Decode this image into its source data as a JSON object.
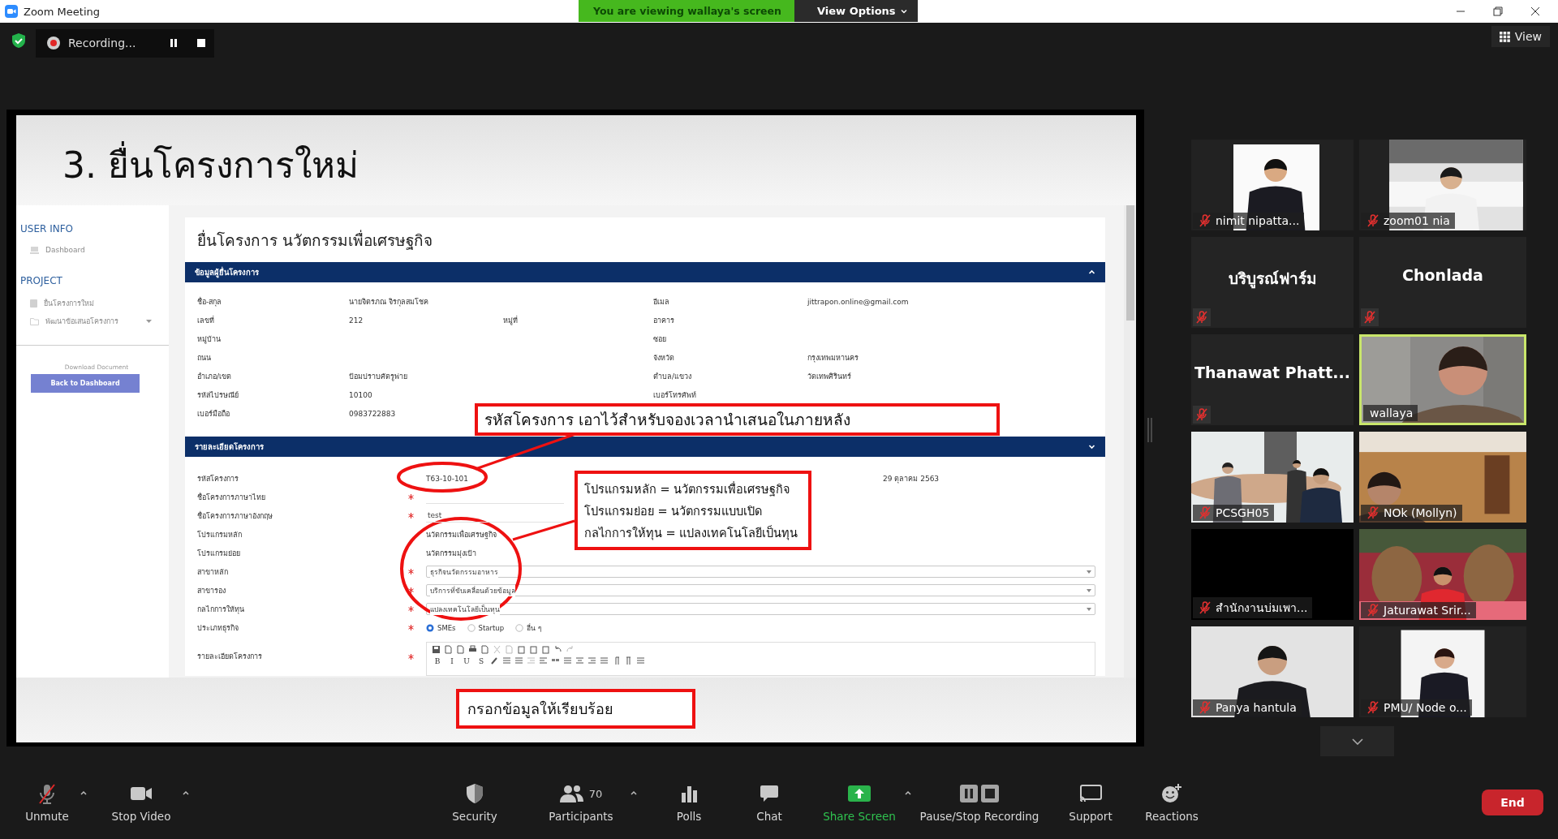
{
  "window": {
    "title": "Zoom Meeting"
  },
  "share_banner": {
    "text": "You are viewing wallaya's screen",
    "view_options": "View Options"
  },
  "recording": {
    "label": "Recording..."
  },
  "view_button": {
    "label": "View"
  },
  "slide": {
    "title": "3. ยื่นโครงการใหม่",
    "sidebar": {
      "sections": [
        {
          "heading": "USER INFO",
          "items": [
            {
              "label": "Dashboard",
              "submenu": false
            }
          ]
        },
        {
          "heading": "PROJECT",
          "items": [
            {
              "label": "ยื่นโครงการใหม่",
              "submenu": false
            },
            {
              "label": "พัฒนาข้อเสนอโครงการ",
              "submenu": true
            }
          ]
        }
      ],
      "download_label": "Download Document",
      "back_button": "Back to Dashboard"
    },
    "form": {
      "title": "ยื่นโครงการ นวัตกรรมเพื่อเศรษฐกิจ",
      "applicant": {
        "title": "ข้อมูลผู้ยื่นโครงการ",
        "expanded": true,
        "rows": [
          {
            "left": {
              "label": "ชื่อ-สกุล",
              "value": "นายจิตรภณ จิรกุลสมโชค"
            },
            "right": {
              "label": "อีเมล",
              "value": "jittrapon.online@gmail.com"
            }
          },
          {
            "left": {
              "label": "เลขที่",
              "value": "212"
            },
            "middle": {
              "label": "หมู่ที่"
            },
            "right": {
              "label": "อาคาร"
            }
          },
          {
            "left": {
              "label": "หมู่บ้าน"
            },
            "right": {
              "label": "ซอย"
            }
          },
          {
            "left": {
              "label": "ถนน"
            },
            "right": {
              "label": "จังหวัด",
              "value": "กรุงเทพมหานคร"
            }
          },
          {
            "left": {
              "label": "อำเภอ/เขต",
              "value": "ป้อมปราบศัตรูพ่าย"
            },
            "right": {
              "label": "ตำบล/แขวง",
              "value": "วัดเทพศิรินทร์"
            }
          },
          {
            "left": {
              "label": "รหัสไปรษณีย์",
              "value": "10100"
            },
            "right": {
              "label": "เบอร์โทรศัพท์"
            }
          },
          {
            "left": {
              "label": "เบอร์มือถือ",
              "value": "0983722883"
            }
          }
        ]
      },
      "details": {
        "title": "รายละเอียดโครงการ",
        "expanded": false,
        "fields": [
          {
            "label": "รหัสโครงการ",
            "required": false,
            "kind": "text",
            "value": "T63-10-101",
            "aside": "29 ตุลาคม 2563"
          },
          {
            "label": "ชื่อโครงการภาษาไทย",
            "required": true,
            "kind": "input"
          },
          {
            "label": "ชื่อโครงการภาษาอังกฤษ",
            "required": true,
            "kind": "input",
            "value": "test"
          },
          {
            "label": "โปรแกรมหลัก",
            "required": false,
            "kind": "text",
            "value": "นวัตกรรมเพื่อเศรษฐกิจ"
          },
          {
            "label": "โปรแกรมย่อย",
            "required": false,
            "kind": "text",
            "value": "นวัตกรรมมุ่งเป้า"
          },
          {
            "label": "สาขาหลัก",
            "required": true,
            "kind": "select",
            "value": "ธุรกิจนวัตกรรมอาหาร"
          },
          {
            "label": "สาขารอง",
            "required": true,
            "kind": "select",
            "value": "บริการที่ขับเคลื่อนด้วยข้อมูล"
          },
          {
            "label": "กลไกการให้ทุน",
            "required": true,
            "kind": "select",
            "value": "แปลงเทคโนโลยีเป็นทุน"
          },
          {
            "label": "ประเภทธุรกิจ",
            "required": true,
            "kind": "radio",
            "options": [
              {
                "label": "SMEs",
                "selected": true
              },
              {
                "label": "Startup",
                "selected": false
              },
              {
                "label": "อื่น ๆ",
                "selected": false
              }
            ]
          },
          {
            "label": "รายละเอียดโครงการ",
            "required": true,
            "kind": "editor",
            "format_buttons": [
              "B",
              "I",
              "U",
              "S"
            ]
          }
        ]
      }
    },
    "callouts": [
      {
        "lines": [
          "รหัสโครงการ เอาไว้สำหรับจองเวลานำเสนอในภายหลัง"
        ]
      },
      {
        "lines": [
          "โปรแกรมหลัก = นวัตกรรมเพื่อเศรษฐกิจ",
          "โปรแกรมย่อย = นวัตกรรมแบบเปิด",
          "กลไกการให้ทุน = แปลงเทคโนโลยีเป็นทุน"
        ]
      },
      {
        "lines": [
          "กรอกข้อมูลให้เรียบร้อย"
        ]
      }
    ]
  },
  "gallery": {
    "tiles": [
      {
        "name": "nimit nipatta...",
        "kind": "picture",
        "muted": true,
        "speaking": false
      },
      {
        "name": "zoom01 nia",
        "kind": "picture",
        "muted": true,
        "speaking": false
      },
      {
        "name": "บริบูรณ์ฟาร์ม",
        "kind": "name",
        "muted": true,
        "speaking": false
      },
      {
        "name": "Chonlada",
        "kind": "name",
        "muted": true,
        "speaking": false
      },
      {
        "name": "Thanawat  Phatt...",
        "kind": "name",
        "muted": true,
        "speaking": false
      },
      {
        "name": "wallaya",
        "kind": "picture",
        "muted": false,
        "speaking": true
      },
      {
        "name": "PCSGH05",
        "kind": "picture",
        "muted": true,
        "speaking": false
      },
      {
        "name": "NOk (Mollyn)",
        "kind": "picture",
        "muted": true,
        "speaking": false
      },
      {
        "name": "สำนักงานบ่มเพา...",
        "kind": "blank",
        "muted": true,
        "speaking": false
      },
      {
        "name": "Jaturawat Srir...",
        "kind": "picture",
        "muted": true,
        "speaking": false
      },
      {
        "name": "Panya hantula",
        "kind": "picture",
        "muted": true,
        "speaking": false
      },
      {
        "name": "PMU/ Node o...",
        "kind": "picture",
        "muted": true,
        "speaking": false
      }
    ]
  },
  "toolbar": {
    "items": [
      {
        "label": "Unmute",
        "kind": "mic_muted",
        "menu": true
      },
      {
        "label": "Stop Video",
        "kind": "camera",
        "menu": true
      },
      {
        "label": "Security",
        "kind": "shield",
        "menu": false
      },
      {
        "label": "Participants",
        "kind": "people",
        "menu": true,
        "count": "70"
      },
      {
        "label": "Polls",
        "kind": "polls",
        "menu": false
      },
      {
        "label": "Chat",
        "kind": "chat",
        "menu": false
      },
      {
        "label": "Share Screen",
        "kind": "share",
        "menu": true
      },
      {
        "label": "Pause/Stop Recording",
        "kind": "recording",
        "menu": false
      },
      {
        "label": "Support",
        "kind": "support",
        "menu": false
      },
      {
        "label": "Reactions",
        "kind": "reactions",
        "menu": false
      }
    ],
    "end_button": "End"
  }
}
